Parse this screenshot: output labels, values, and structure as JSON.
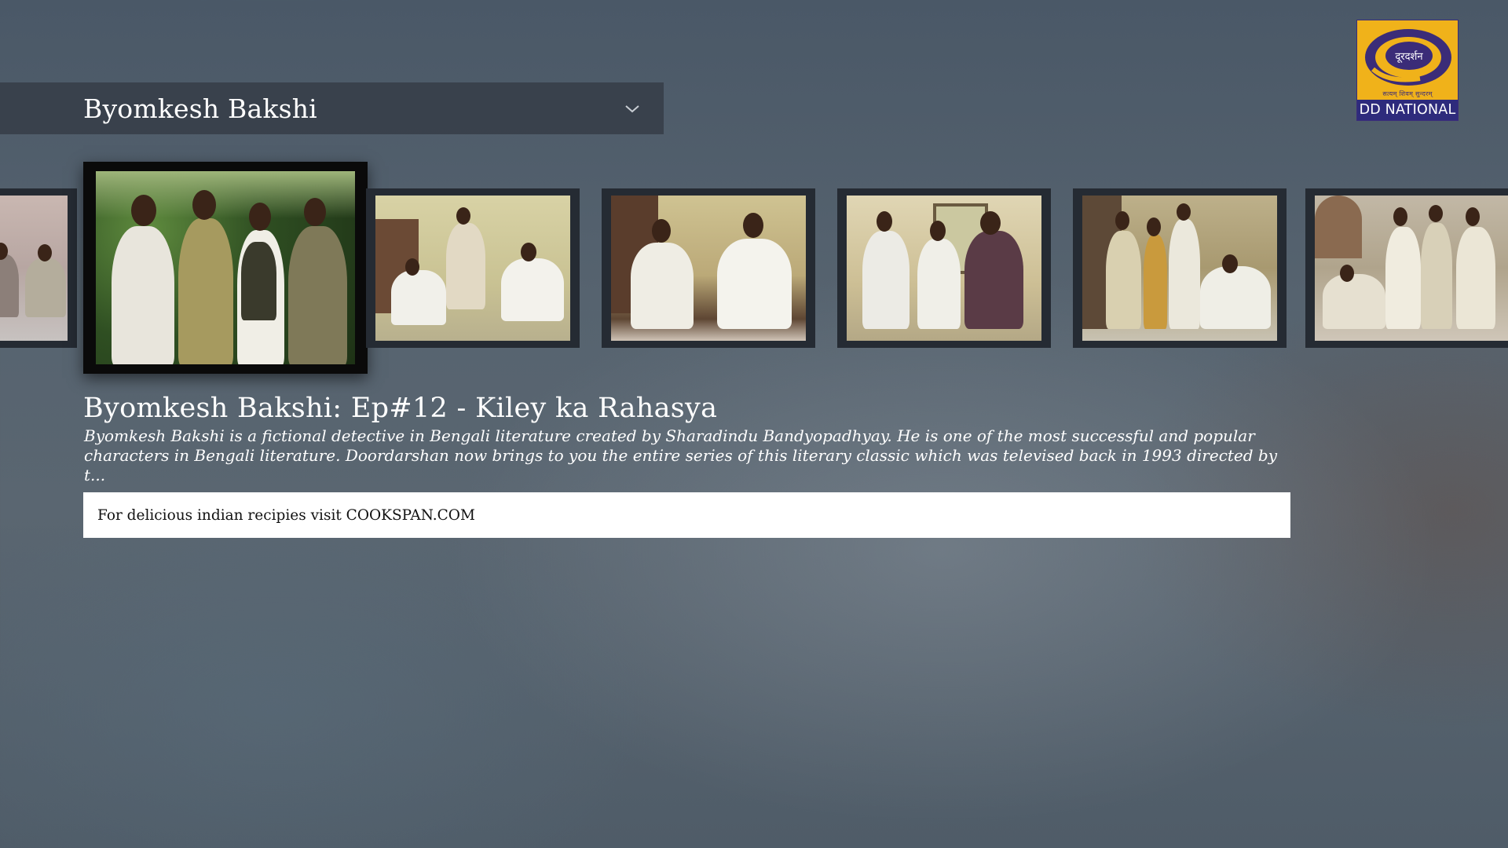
{
  "header": {
    "show_title": "Byomkesh Bakshi"
  },
  "channel": {
    "brand": "DD NATIONAL",
    "hindi_wordmark": "दूरदर्शन",
    "motto": "सत्यम् शिवम् सुन्दरम्",
    "colors": {
      "gold": "#f0b21a",
      "indigo": "#2e2b7c"
    }
  },
  "episodes": [
    {
      "label": "Episode thumbnail",
      "focused": false
    },
    {
      "label": "Episode thumbnail",
      "focused": true
    },
    {
      "label": "Episode thumbnail",
      "focused": false
    },
    {
      "label": "Episode thumbnail",
      "focused": false
    },
    {
      "label": "Episode thumbnail",
      "focused": false
    },
    {
      "label": "Episode thumbnail",
      "focused": false
    },
    {
      "label": "Episode thumbnail",
      "focused": false
    }
  ],
  "selected_episode": {
    "title": "Byomkesh Bakshi: Ep#12 - Kiley ka Rahasya",
    "description_line1": "Byomkesh Bakshi is a fictional detective in Bengali literature created by Sharadindu Bandyopadhyay. He is one of the most successful and popular",
    "description_line2": "characters in Bengali literature. Doordarshan now brings to you the entire series of this literary classic which was televised back in 1993 directed by t..."
  },
  "ad": {
    "text": "For delicious indian recipies visit COOKSPAN.COM"
  }
}
